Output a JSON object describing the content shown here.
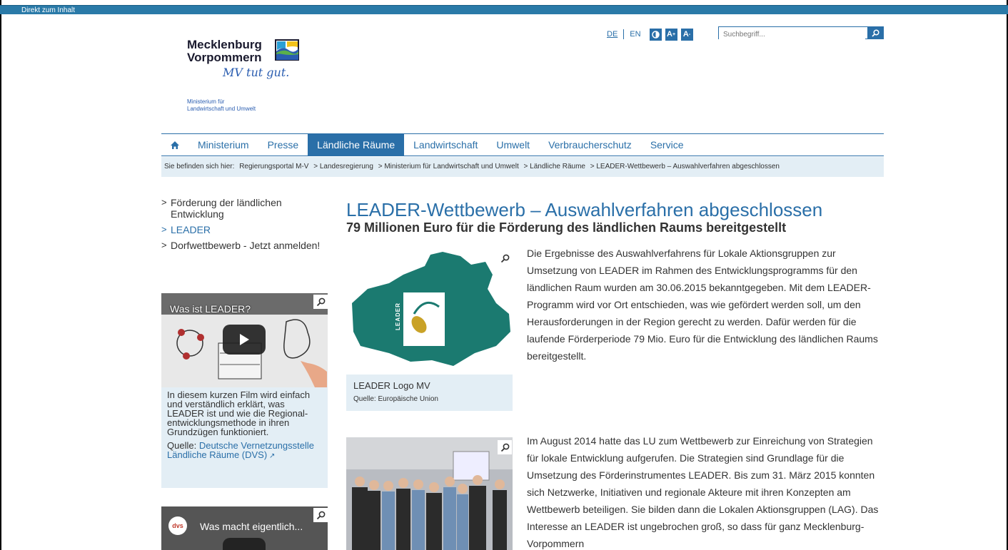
{
  "skip_link": "Direkt zum Inhalt",
  "logo": {
    "line1": "Mecklenburg",
    "line2": "Vorpommern",
    "slogan": "MV tut gut.",
    "ministry_line1": "Ministerium für",
    "ministry_line2": "Landwirtschaft und Umwelt"
  },
  "util": {
    "lang_de": "DE",
    "lang_en": "EN",
    "contrast_icon": "contrast-icon",
    "font_up": "A",
    "font_down": "A",
    "search_placeholder": "Suchbegriff..."
  },
  "nav": {
    "items": [
      "Ministerium",
      "Presse",
      "Ländliche Räume",
      "Landwirtschaft",
      "Umwelt",
      "Verbraucherschutz",
      "Service"
    ]
  },
  "breadcrumb": {
    "prefix": "Sie befinden sich hier:",
    "items": [
      "Regierungsportal M-V",
      "> Landesregierung",
      "> Ministerium für Landwirtschaft und Umwelt",
      "> Ländliche Räume",
      "> LEADER-Wettbewerb – Auswahlverfahren abgeschlossen"
    ]
  },
  "sidebar": {
    "links": [
      "Förderung der ländlichen Entwicklung",
      "LEADER",
      "Dorfwettbewerb - Jetzt anmelden!"
    ]
  },
  "video1": {
    "title": "Was ist LEADER?",
    "caption": "In diesem kurzen Film wird einfach und verständlich erklärt, was LEADER ist und wie die Regional-entwicklungsmethode in ihren Grundzügen funktioniert.",
    "source_label": "Quelle:",
    "source_link": "Deutsche Vernetzungsstelle Ländliche Räume (DVS)"
  },
  "video2": {
    "title": "Was macht eigentlich...",
    "badge": "dvs"
  },
  "main": {
    "title": "LEADER-Wettbewerb – Auswahlverfahren abgeschlossen",
    "subtitle": "79 Millionen Euro für die Förderung des ländlichen Raums bereitgestellt",
    "img1_caption": "LEADER Logo MV",
    "img1_source": "Quelle: Europäische Union",
    "para1": "Die Ergebnisse des Auswahlverfahrens für Lokale Aktionsgruppen zur Umsetzung von LEADER im Rahmen des Entwicklungsprogramms für den ländlichen Raum wurden am 30.06.2015 bekanntgegeben. Mit dem LEADER-Programm wird vor Ort entschieden, was wie gefördert werden soll, um den Herausforderungen in der Region gerecht zu werden. Dafür werden für die laufende Förderperiode 79 Mio. Euro für die Entwicklung des ländlichen Raums bereitgestellt.",
    "para2": "Im August 2014 hatte das LU zum Wettbewerb zur Einreichung von Strategien für lokale Entwicklung aufgerufen. Die Strategien sind Grundlage für die Umsetzung des Förderinstrumentes LEADER. Bis zum 31. März 2015 konnten sich Netzwerke, Initiativen und regionale Akteure mit ihren Konzepten am Wettbewerb beteiligen. Sie bilden dann die Lokalen Aktionsgruppen (LAG). Das Interesse an LEADER ist ungebrochen groß, so dass für ganz Mecklenburg-Vorpommern",
    "logo_text": "LEADER"
  }
}
